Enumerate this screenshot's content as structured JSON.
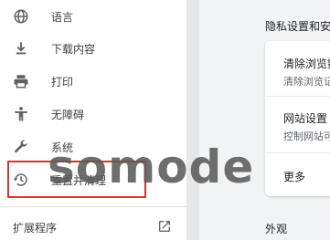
{
  "sidebar": {
    "items": [
      {
        "label": "语言",
        "icon": "globe-icon"
      },
      {
        "label": "下载内容",
        "icon": "download-icon"
      },
      {
        "label": "打印",
        "icon": "printer-icon"
      },
      {
        "label": "无障碍",
        "icon": "accessibility-icon"
      },
      {
        "label": "系统",
        "icon": "wrench-icon"
      },
      {
        "label": "重置并清理",
        "icon": "history-icon"
      }
    ],
    "extensions": {
      "label": "扩展程序",
      "icon": "open-in-new-icon"
    }
  },
  "main": {
    "section_title": "隐私设置和安全性",
    "rows": [
      {
        "title": "清除浏览数据",
        "subtitle": "清除浏览记录"
      },
      {
        "title": "网站设置",
        "subtitle": "控制网站可以"
      }
    ],
    "more": "更多",
    "appearance": "外观"
  },
  "watermark": "somode",
  "colors": {
    "highlight": "#d9342b",
    "icon": "#5f6368"
  }
}
